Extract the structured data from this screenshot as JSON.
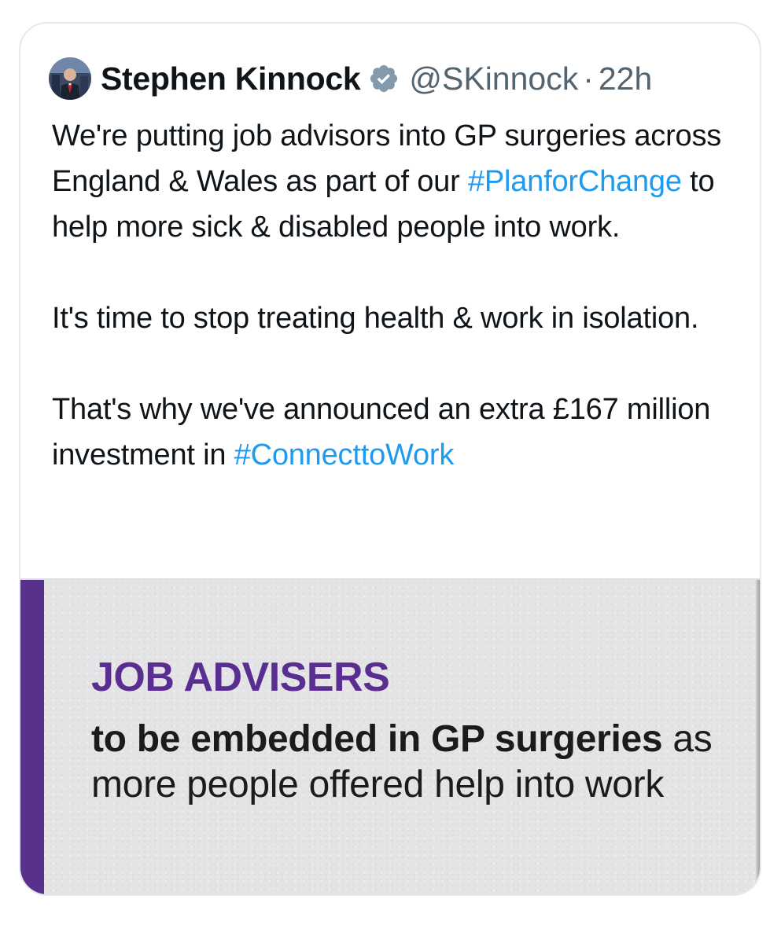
{
  "tweet": {
    "author": {
      "name": "Stephen Kinnock",
      "handle": "@SKinnock",
      "separator": "·",
      "time": "22h",
      "verified_icon": "verified-badge-icon",
      "verified_color": "#829aab"
    },
    "paragraphs": [
      {
        "before": "We're putting job advisors into GP surgeries across England & Wales as part of our ",
        "hashtag": "#PlanforChange",
        "after": " to help more sick & disabled people into work."
      },
      {
        "text": "It's time to stop treating health & work in isolation."
      },
      {
        "before": "That's why we've announced an extra £167 million investment in ",
        "hashtag": "#ConnecttoWork",
        "after": ""
      }
    ],
    "hashtag_color": "#1d9bf0"
  },
  "media": {
    "headline": "JOB ADVISERS",
    "subhead_bold": "to be embedded in GP surgeries",
    "subhead_regular": " as more people offered help into work",
    "accent_color": "#58318c",
    "headline_color": "#5a2d91"
  }
}
